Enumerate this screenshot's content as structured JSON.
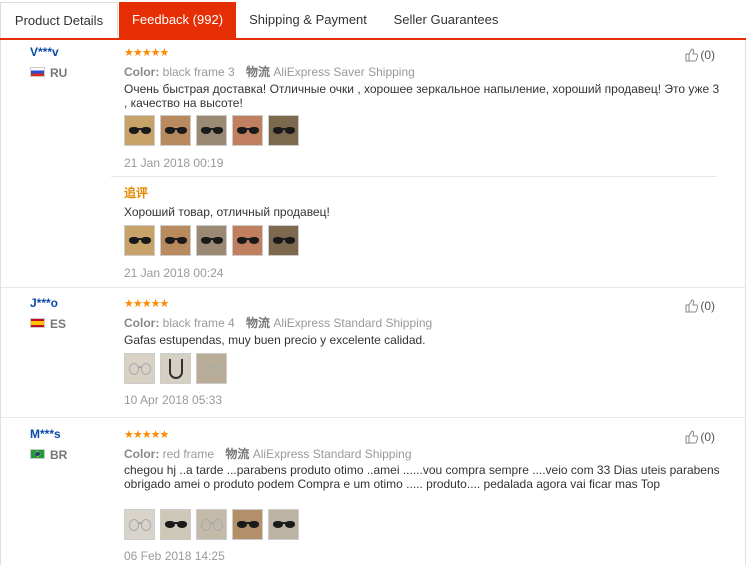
{
  "tabs": [
    {
      "label": "Product Details"
    },
    {
      "label": "Feedback (992)"
    },
    {
      "label": "Shipping & Payment"
    },
    {
      "label": "Seller Guarantees"
    }
  ],
  "colors": {
    "accent": "#e62e04",
    "star": "#ff8a00",
    "username": "#0b4aa8",
    "followup": "#e48a00"
  },
  "reviews": [
    {
      "user": "V***v",
      "country": "RU",
      "flag": "russia-flag",
      "stars": "★★★★★",
      "color_key": "Color:",
      "color_value": "black frame 3",
      "logistics_key": "物流",
      "logistics_value": "AliExpress Saver Shipping",
      "text": "Очень быстрая доставка! Отличные очки , хорошее зеркальное напыление, хороший продавец! Это уже 3 , качество на высоте!",
      "date": "21 Jan 2018 00:19",
      "likes": "(0)",
      "followup": {
        "label": "追评",
        "text": "Хороший товар, отличный продавец!",
        "date": "21 Jan 2018 00:24"
      }
    },
    {
      "user": "J***o",
      "country": "ES",
      "flag": "spain-flag",
      "stars": "★★★★★",
      "color_key": "Color:",
      "color_value": "black frame 4",
      "logistics_key": "物流",
      "logistics_value": "AliExpress Standard Shipping",
      "text": "Gafas estupendas, muy buen precio y excelente calidad.",
      "date": "10 Apr 2018 05:33",
      "likes": "(0)"
    },
    {
      "user": "M***s",
      "country": "BR",
      "flag": "brazil-flag",
      "stars": "★★★★★",
      "color_key": "Color:",
      "color_value": "red frame",
      "logistics_key": "物流",
      "logistics_value": "AliExpress Standard Shipping",
      "text": "chegou hj ..a tarde ...parabens produto otimo ..amei ......vou compra sempre ....veio com 33 Dias uteis parabens obrigado amei o produto podem Compra e um otimo ..... produto.... pedalada agora vai ficar mas Top",
      "date": "06 Feb 2018 14:25",
      "likes": "(0)"
    }
  ]
}
